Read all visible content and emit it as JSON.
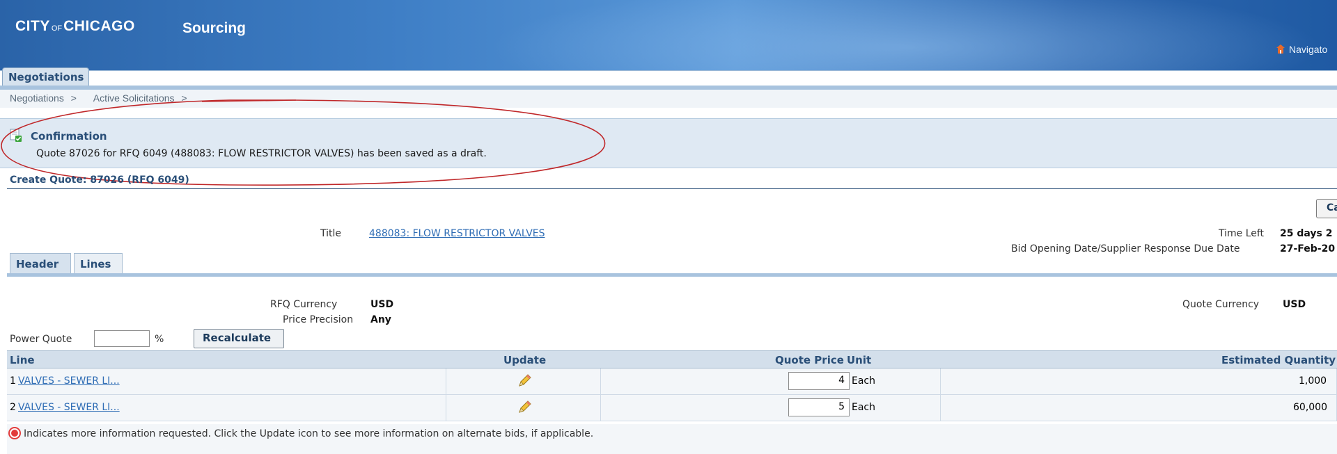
{
  "brand": {
    "city": "CITY",
    "of": "OF",
    "chicago": "CHICAGO",
    "app": "Sourcing"
  },
  "header": {
    "navigator": "Navigato"
  },
  "tabs": {
    "main": "Negotiations"
  },
  "breadcrumbs": [
    "Negotiations",
    ">",
    "Active Solicitations",
    ">"
  ],
  "confirmation": {
    "heading": "Confirmation",
    "message": "Quote 87026 for RFQ 6049 (488083: FLOW RESTRICTOR VALVES) has been saved as a draft."
  },
  "page": {
    "title": "Create Quote: 87026 (RFQ 6049)",
    "cancel_label": "Ca",
    "title_label": "Title",
    "title_value": "488083: FLOW RESTRICTOR VALVES",
    "time_left_label": "Time Left",
    "time_left_value": "25 days 2",
    "due_label": "Bid Opening Date/Supplier Response Due Date",
    "due_value": "27-Feb-20"
  },
  "subtabs": {
    "header": "Header",
    "lines": "Lines"
  },
  "lines_info": {
    "rfq_currency_label": "RFQ Currency",
    "rfq_currency_value": "USD",
    "price_precision_label": "Price Precision",
    "price_precision_value": "Any",
    "quote_currency_label": "Quote Currency",
    "quote_currency_value": "USD",
    "power_quote_label": "Power Quote",
    "power_quote_value": "",
    "percent": "%",
    "recalculate_label": "Recalculate"
  },
  "table": {
    "columns": {
      "line": "Line",
      "update": "Update",
      "quote_price": "Quote Price",
      "unit": "Unit",
      "estimated_quantity": "Estimated Quantity"
    },
    "rows": [
      {
        "num": "1",
        "item": "VALVES - SEWER LI...",
        "quote_price": "4",
        "unit": "Each",
        "quantity": "1,000"
      },
      {
        "num": "2",
        "item": "VALVES - SEWER LI...",
        "quote_price": "5",
        "unit": "Each",
        "quantity": "60,000"
      }
    ]
  },
  "footnote": "Indicates more information requested. Click the Update icon to see more information on alternate bids, if applicable.",
  "colors": {
    "banner": "#2a63a8",
    "link": "#2f6db5",
    "annotation": "#c0282a"
  }
}
